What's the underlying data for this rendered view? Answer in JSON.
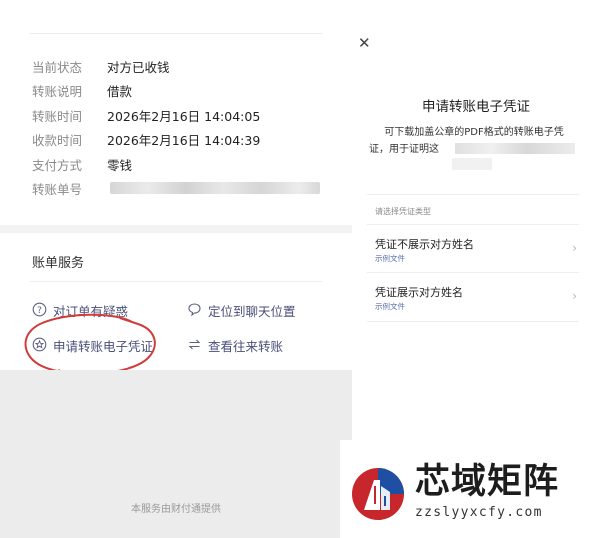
{
  "detail": {
    "rows": [
      {
        "label": "当前状态",
        "value": "对方已收钱"
      },
      {
        "label": "转账说明",
        "value": "借款"
      },
      {
        "label": "转账时间",
        "value": "2026年2月16日 14:04:05"
      },
      {
        "label": "收款时间",
        "value": "2026年2月16日 14:04:39"
      },
      {
        "label": "支付方式",
        "value": "零钱"
      },
      {
        "label": "转账单号",
        "value": ""
      }
    ]
  },
  "services": {
    "title": "账单服务",
    "items": [
      {
        "label": "对订单有疑惑",
        "icon": "question-circle-icon"
      },
      {
        "label": "定位到聊天位置",
        "icon": "chat-bubble-icon"
      },
      {
        "label": "申请转账电子凭证",
        "icon": "star-circle-icon"
      },
      {
        "label": "查看往来转账",
        "icon": "swap-arrows-icon"
      }
    ],
    "annotation_color": "#d23b3b",
    "link_color": "#4a4e7a"
  },
  "footer": "本服务由财付通提供",
  "dialog": {
    "close_icon": "close-icon",
    "title": "申请转账电子凭证",
    "description_line1": "可下载加盖公章的PDF格式的转账电子凭",
    "description_line2": "证，用于证明这",
    "options_hint": "请选择凭证类型",
    "options": [
      {
        "title": "凭证不展示对方姓名",
        "sub": "示例文件"
      },
      {
        "title": "凭证展示对方姓名",
        "sub": "示例文件"
      }
    ]
  },
  "watermark": {
    "name": "芯域矩阵",
    "url": "zzslyyxcfy.com",
    "brand_colors": [
      "#c8262d",
      "#1e4fa3"
    ]
  }
}
